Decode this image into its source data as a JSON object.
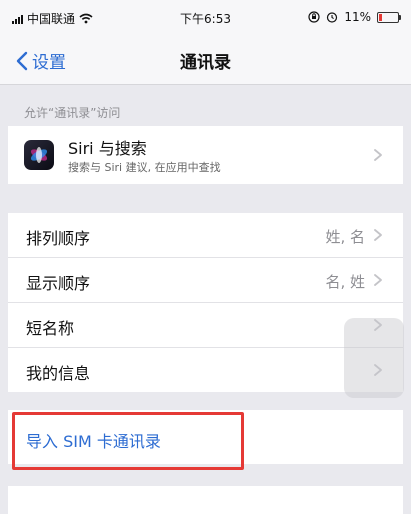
{
  "status_bar": {
    "carrier": "中国联通",
    "time": "下午6:53",
    "battery": "11%"
  },
  "nav": {
    "back_label": "设置",
    "title": "通讯录"
  },
  "section": {
    "header": "允许“通讯录”访问"
  },
  "siri": {
    "title": "Siri 与搜索",
    "subtitle": "搜索与 Siri 建议, 在应用中查找"
  },
  "settings": [
    {
      "label": "排列顺序",
      "value": "姓, 名"
    },
    {
      "label": "显示顺序",
      "value": "名, 姓"
    },
    {
      "label": "短名称",
      "value": ""
    },
    {
      "label": "我的信息",
      "value": ""
    }
  ],
  "import": {
    "label": "导入 SIM 卡通讯录"
  },
  "colors": {
    "accent": "#2d6cd2",
    "highlight": "#e53935",
    "background": "#e9e9ee"
  }
}
